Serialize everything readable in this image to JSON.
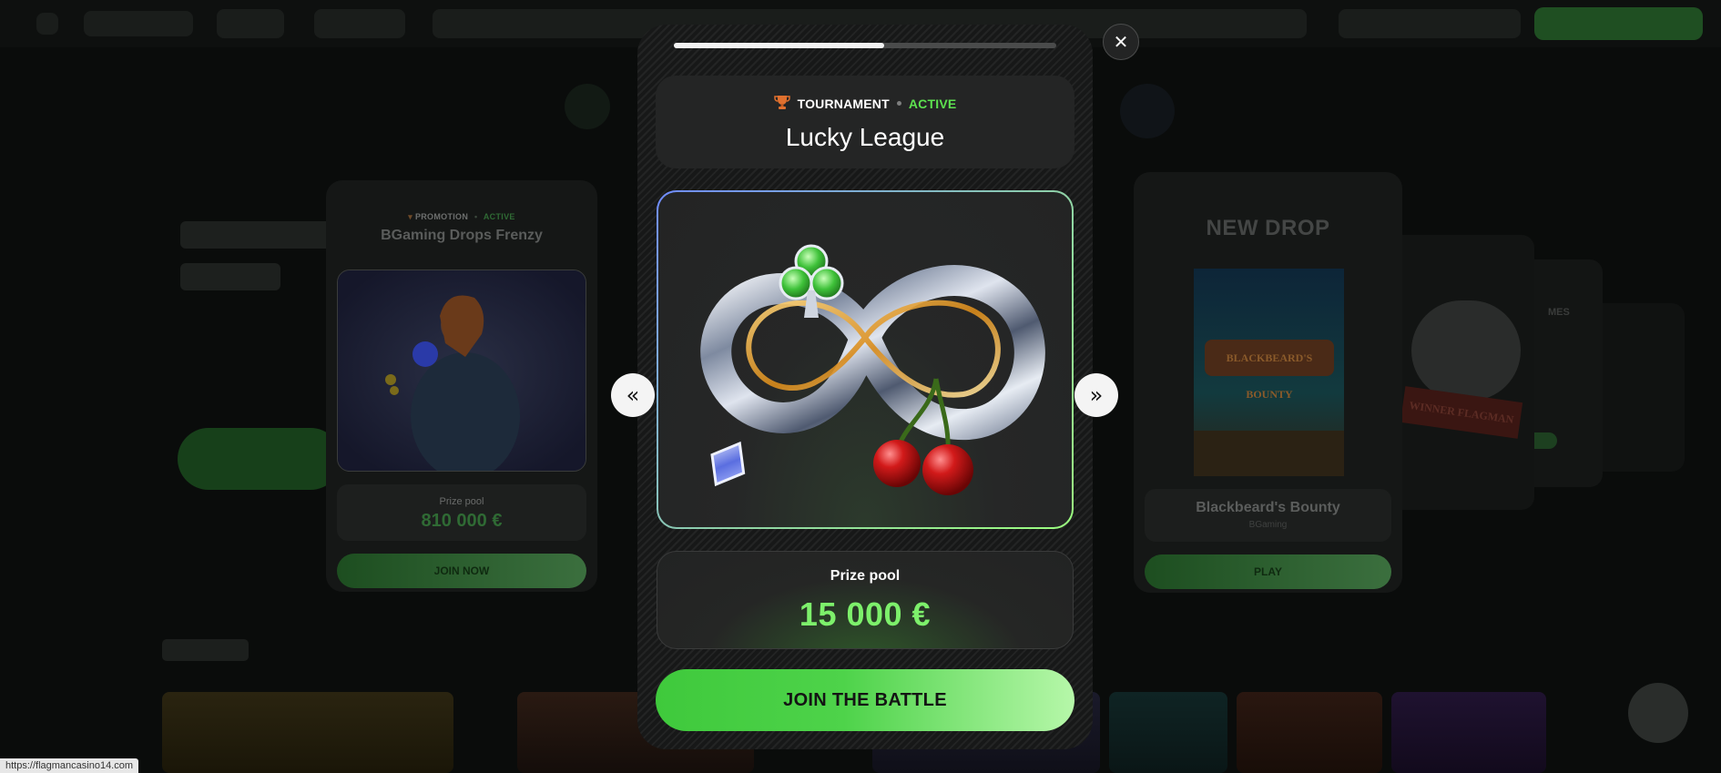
{
  "background": {
    "status_url": "https://flagmancasino14.com",
    "left_card": {
      "kind": "PROMOTION",
      "status": "ACTIVE",
      "title": "BGaming Drops Frenzy",
      "prize_label": "Prize pool",
      "prize_amount": "810 000 €",
      "button_label": "JOIN NOW"
    },
    "right_card": {
      "heading": "NEW DROP",
      "game_logo": "BLACKBEARD'S BOUNTY",
      "game_title": "Blackbeard's Bounty",
      "provider": "BGaming",
      "button_label": "PLAY"
    },
    "far_right_card": {
      "badge": "WINNER FLAGMAN"
    }
  },
  "modal": {
    "progress": 0.55,
    "header": {
      "kind": "TOURNAMENT",
      "status": "ACTIVE",
      "title": "Lucky League"
    },
    "artwork": {
      "icons": [
        "trophy-icon",
        "club-icon",
        "infinity-icon",
        "diamond-icon",
        "cherries-icon"
      ]
    },
    "prize": {
      "label": "Prize pool",
      "amount": "15 000 €"
    },
    "cta_label": "JOIN THE BATTLE",
    "nav": {
      "prev_glyph": "«",
      "next_glyph": "»"
    },
    "close_glyph": "✕"
  },
  "colors": {
    "accent_green": "#5de04f",
    "prize_green": "#7df06b",
    "cta_gradient_start": "#3fc93c",
    "cta_gradient_end": "#b6f7a9"
  }
}
